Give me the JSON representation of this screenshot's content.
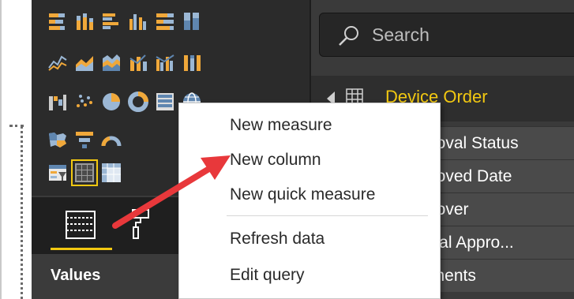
{
  "search": {
    "placeholder": "Search"
  },
  "fields": {
    "table_name": "Device Order",
    "items": [
      {
        "label": "Approval Status",
        "visible_text": "proval Status"
      },
      {
        "label": "Approved Date",
        "visible_text": "proved Date"
      },
      {
        "label": "Approver",
        "visible_text": "prover"
      },
      {
        "label": "Capital Approval",
        "visible_text": "pital Appro..."
      },
      {
        "label": "Comments",
        "visible_text": "nments"
      }
    ]
  },
  "visualizations": {
    "icons": [
      "stacked-bar-chart-icon",
      "stacked-column-chart-icon",
      "clustered-bar-chart-icon",
      "clustered-column-chart-icon",
      "100-percent-stacked-bar-chart-icon",
      "100-percent-stacked-column-chart-icon",
      "line-chart-icon",
      "area-chart-icon",
      "stacked-area-chart-icon",
      "line-and-stacked-column-chart-icon",
      "line-and-clustered-column-chart-icon",
      "ribbon-chart-icon",
      "waterfall-chart-icon",
      "scatter-chart-icon",
      "pie-chart-icon",
      "donut-chart-icon",
      "treemap-icon",
      "map-icon",
      "filled-map-icon",
      "funnel-icon",
      "gauge-icon",
      "slicer-icon",
      "table-icon",
      "matrix-icon"
    ],
    "selected_icon": "table-icon",
    "tabs": [
      "fields-tab",
      "format-tab"
    ],
    "active_tab": "fields-tab",
    "values_label": "Values"
  },
  "context_menu": {
    "items": [
      "New measure",
      "New column",
      "New quick measure",
      "Refresh data",
      "Edit query"
    ]
  },
  "colors": {
    "accent": "#f2c811",
    "pane_dark": "#2b2b2b",
    "annotation_arrow": "#e8383b"
  }
}
